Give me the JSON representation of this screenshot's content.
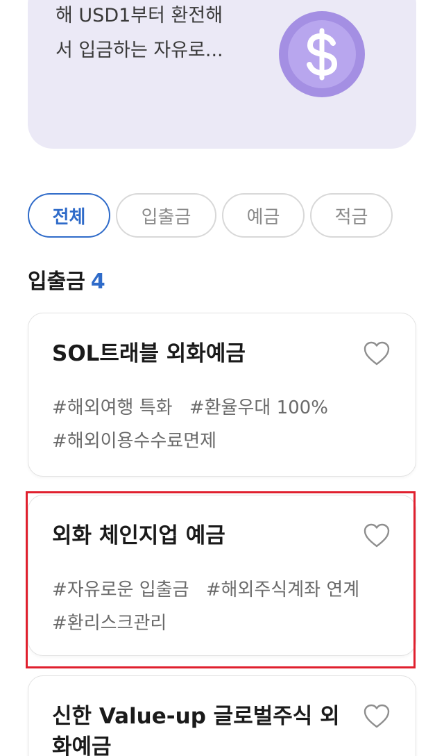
{
  "promo": {
    "line1": "해 USD1부터 환전해",
    "line2": "서 입금하는 자유로...",
    "icon": "dollar-coin-icon",
    "bg_color": "#ebe9f6",
    "coin_color": "#a48fe3"
  },
  "filters": {
    "items": [
      {
        "label": "전체",
        "selected": true
      },
      {
        "label": "입출금",
        "selected": false
      },
      {
        "label": "예금",
        "selected": false
      },
      {
        "label": "적금",
        "selected": false
      }
    ],
    "accent_color": "#2f6bc9"
  },
  "section": {
    "title": "입출금",
    "count": "4"
  },
  "products": [
    {
      "title": "SOL트래블 외화예금",
      "tags": [
        "#해외여행 특화",
        "#환율우대 100%",
        "#해외이용수수료면제"
      ],
      "icon": "heart-icon"
    },
    {
      "title": "외화 체인지업 예금",
      "tags": [
        "#자유로운 입출금",
        "#해외주식계좌 연계",
        "#환리스크관리"
      ],
      "icon": "heart-icon"
    },
    {
      "title": "신한 Value-up 글로벌주식 외화예금",
      "tags": [],
      "icon": "heart-icon"
    }
  ],
  "highlight_color": "#e0202e"
}
